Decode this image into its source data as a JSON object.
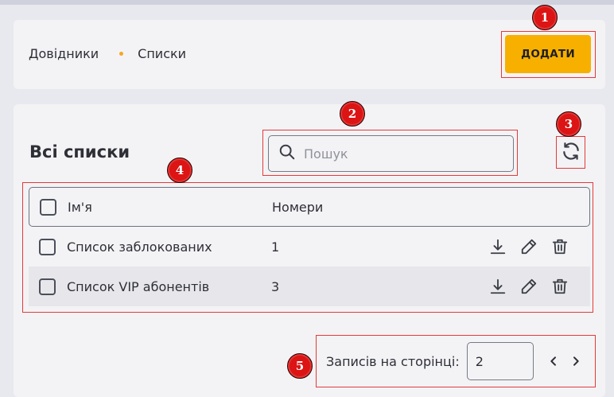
{
  "breadcrumb": {
    "items": [
      "Довідники",
      "Списки"
    ]
  },
  "toolbar": {
    "add_label": "ДОДАТИ"
  },
  "page": {
    "title": "Всі списки"
  },
  "search": {
    "placeholder": "Пошук",
    "value": ""
  },
  "table": {
    "headers": [
      "Ім'я",
      "Номери"
    ],
    "rows": [
      {
        "name": "Список заблокованих",
        "numbers": "1"
      },
      {
        "name": "Список VIP абонентів",
        "numbers": "3"
      }
    ]
  },
  "pagination": {
    "label": "Записів на сторінці:",
    "per_page": "2"
  },
  "annotations": [
    "1",
    "2",
    "3",
    "4",
    "5"
  ],
  "colors": {
    "accent": "#f8b000",
    "highlight": "#e43a3a",
    "badge": "#dc1414",
    "breadcrumb_dot": "#f5a623"
  },
  "icons": [
    "search-icon",
    "refresh-icon",
    "download-icon",
    "edit-icon",
    "trash-icon",
    "chevron-left-icon",
    "chevron-right-icon"
  ]
}
